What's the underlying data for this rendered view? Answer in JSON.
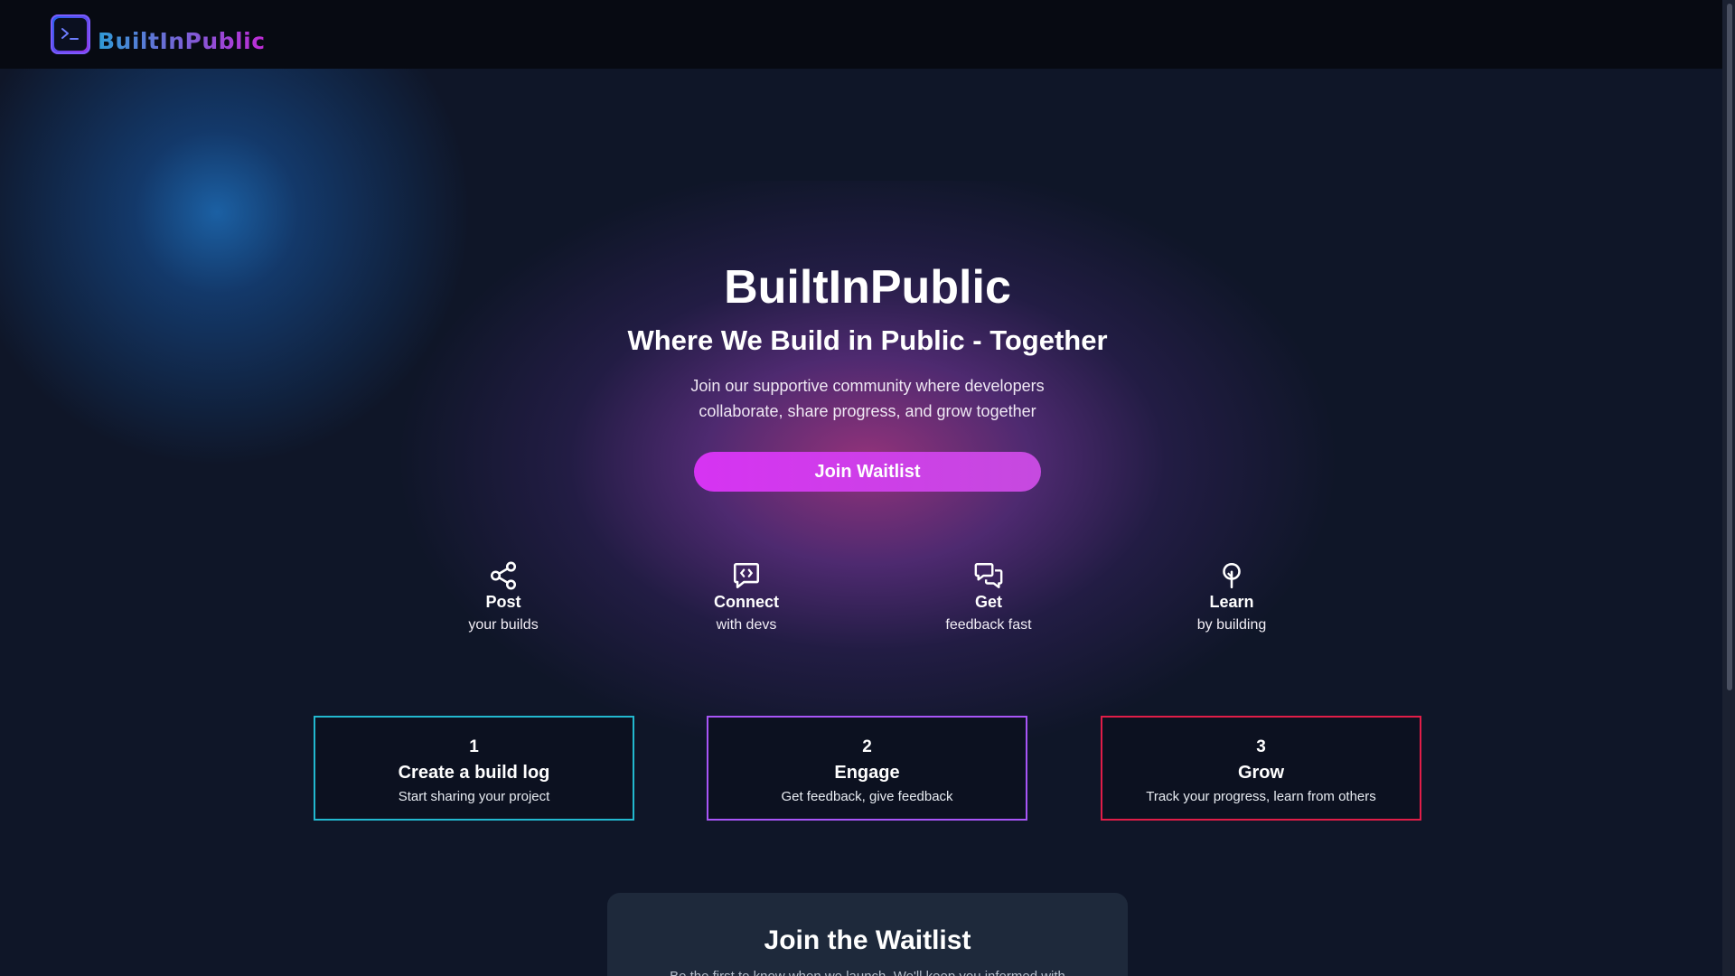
{
  "colors": {
    "background": "#0f1628",
    "header_bg": "#070a12",
    "accent_button": "#d633f2",
    "card1_border": "#22b8cf",
    "card2_border": "#a855f7",
    "card3_border": "#e11d48",
    "panel_bg": "#1e293b"
  },
  "header": {
    "logo_icon": "terminal-icon",
    "logo_text": "BuiltInPublic"
  },
  "hero": {
    "title": "BuiltInPublic",
    "subtitle": "Where We Build in Public - Together",
    "description_line1": "Join our supportive community where developers",
    "description_line2": "collaborate, share progress, and grow together",
    "cta_label": "Join Waitlist"
  },
  "features": [
    {
      "icon": "share-icon",
      "title": "Post",
      "subtitle": "your builds"
    },
    {
      "icon": "code-message-icon",
      "title": "Connect",
      "subtitle": "with devs"
    },
    {
      "icon": "chat-bubbles-icon",
      "title": "Get",
      "subtitle": "feedback fast"
    },
    {
      "icon": "tree-icon",
      "title": "Learn",
      "subtitle": "by building"
    }
  ],
  "steps": [
    {
      "number": "1",
      "title": "Create a build log",
      "description": "Start sharing your project"
    },
    {
      "number": "2",
      "title": "Engage",
      "description": "Get feedback, give feedback"
    },
    {
      "number": "3",
      "title": "Grow",
      "description": "Track your progress, learn from others"
    }
  ],
  "waitlist": {
    "title": "Join the Waitlist",
    "description": "Be the first to know when we launch. We'll keep you informed with"
  }
}
